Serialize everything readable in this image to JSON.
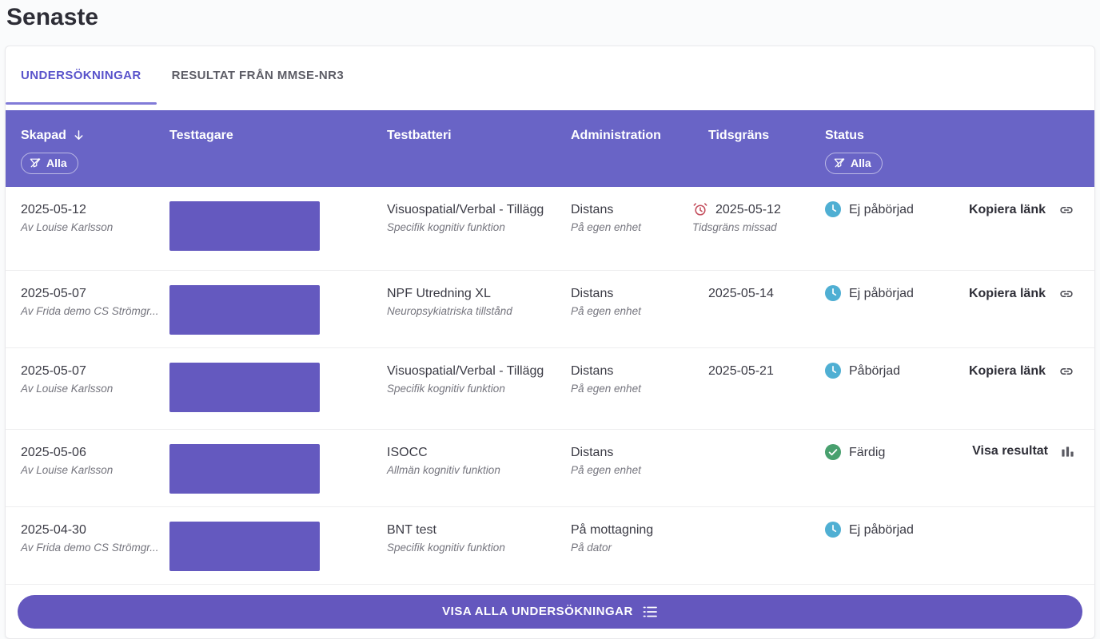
{
  "page": {
    "title": "Senaste"
  },
  "tabs": [
    {
      "label": "UNDERSÖKNINGAR"
    },
    {
      "label": "RESULTAT FRÅN MMSE-NR3"
    }
  ],
  "table": {
    "columns": {
      "skapad": "Skapad",
      "testtagare": "Testtagare",
      "testbatteri": "Testbatteri",
      "administration": "Administration",
      "tidsgrans": "Tidsgräns",
      "status": "Status"
    },
    "sort": {
      "column": "Skapad",
      "direction": "descending",
      "icon": "arrow-down-icon"
    },
    "filters": {
      "skapad": {
        "label": "Alla",
        "icon": "filter-off-icon"
      },
      "status": {
        "label": "Alla",
        "icon": "filter-off-icon"
      }
    },
    "rows": [
      {
        "created": "2025-05-12",
        "created_by": "Av Louise Karlsson",
        "battery": "Visuospatial/Verbal - Tillägg",
        "battery_category": "Specifik kognitiv funktion",
        "administration": "Distans",
        "administration_detail": "På egen enhet",
        "deadline": "2025-05-12",
        "deadline_note": "Tidsgräns missad",
        "deadline_icon": "alarm-clock-icon",
        "status": "Ej påbörjad",
        "status_icon": "clock-icon",
        "action": "Kopiera länk",
        "action_icon": "link-icon"
      },
      {
        "created": "2025-05-07",
        "created_by": "Av Frida demo CS Strömgr...",
        "battery": "NPF Utredning XL",
        "battery_category": "Neuropsykiatriska tillstånd",
        "administration": "Distans",
        "administration_detail": "På egen enhet",
        "deadline": "2025-05-14",
        "status": "Ej påbörjad",
        "status_icon": "clock-icon",
        "action": "Kopiera länk",
        "action_icon": "link-icon"
      },
      {
        "created": "2025-05-07",
        "created_by": "Av Louise Karlsson",
        "battery": "Visuospatial/Verbal - Tillägg",
        "battery_category": "Specifik kognitiv funktion",
        "administration": "Distans",
        "administration_detail": "På egen enhet",
        "deadline": "2025-05-21",
        "status": "Påbörjad",
        "status_icon": "clock-icon",
        "action": "Kopiera länk",
        "action_icon": "link-icon"
      },
      {
        "created": "2025-05-06",
        "created_by": "Av Louise Karlsson",
        "battery": "ISOCC",
        "battery_category": "Allmän kognitiv funktion",
        "administration": "Distans",
        "administration_detail": "På egen enhet",
        "status": "Färdig",
        "status_icon": "check-circle-icon",
        "action": "Visa resultat",
        "action_icon": "bar-chart-icon"
      },
      {
        "created": "2025-04-30",
        "created_by": "Av Frida demo CS Strömgr...",
        "battery": "BNT test",
        "battery_category": "Specifik kognitiv funktion",
        "administration": "På mottagning",
        "administration_detail": "På dator",
        "status": "Ej påbörjad",
        "status_icon": "clock-icon"
      }
    ]
  },
  "footer": {
    "button_label": "VISA ALLA UNDERSÖKNINGAR",
    "button_icon": "ordered-list-icon"
  },
  "colors": {
    "accent_purple": "#6457BE",
    "header_purple": "#6964C6",
    "redacted_purple": "#6459BF",
    "tab_active_purple": "#5953CB",
    "status_pending_blue": "#4FAFD3",
    "status_done_green": "#48A06E",
    "deadline_missed_red": "#C44F5E"
  }
}
